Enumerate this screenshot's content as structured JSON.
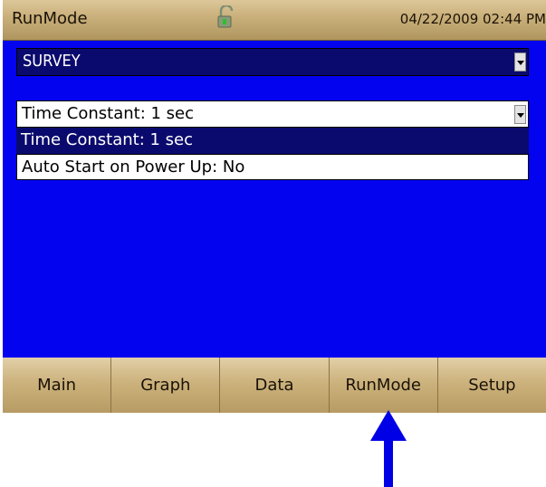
{
  "header": {
    "title": "RunMode",
    "datetime": "04/22/2009 02:44 PM",
    "lock_icon": "unlocked-padlock-icon"
  },
  "mode_select": {
    "value": "SURVEY"
  },
  "settings_select": {
    "value": "Time Constant: 1 sec",
    "options": [
      "Time Constant: 1 sec",
      "Auto Start on Power Up: No"
    ],
    "selected_index": 0
  },
  "tabs": [
    "Main",
    "Graph",
    "Data",
    "RunMode",
    "Setup"
  ],
  "active_tab": "RunMode",
  "colors": {
    "screen_bg": "#0303f0",
    "selected_bg": "#0a0a6e",
    "bar_gold": "#c8ae78",
    "pointer": "#0000e6"
  }
}
